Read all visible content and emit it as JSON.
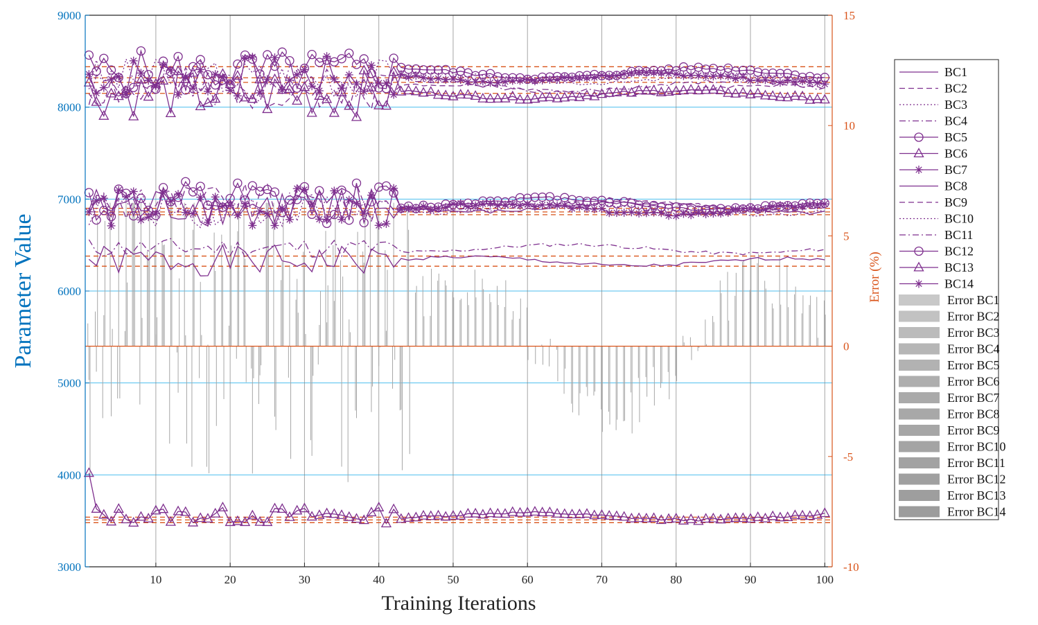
{
  "chart_data": {
    "type": "line",
    "xlabel": "Training Iterations",
    "ylabel_left": "Parameter Value",
    "ylabel_right": "Error (%)",
    "xlim": [
      0.5,
      101
    ],
    "xticks": [
      10,
      20,
      30,
      40,
      50,
      60,
      70,
      80,
      90,
      100
    ],
    "ylim_left": [
      3000,
      9000
    ],
    "yticks_left": [
      3000,
      4000,
      5000,
      6000,
      7000,
      8000,
      9000
    ],
    "ylim_right": [
      -10,
      15
    ],
    "yticks_right": [
      -10,
      -5,
      0,
      5,
      10,
      15
    ],
    "yticks_right_labels": [
      "-10",
      "-5",
      "0",
      "5",
      "10",
      "15"
    ],
    "grid": "on",
    "legend_position": "outside-right",
    "colors": {
      "series": "#7E2F8E",
      "error_axis": "#D95319",
      "reference": "#D95319",
      "grid_h": "#4DBEEE",
      "grid_v": "#808080",
      "error_bars": "#A6A6A6"
    },
    "series": [
      {
        "name": "BC1",
        "style": "solid",
        "marker": "none",
        "group": 3,
        "base": 6330,
        "amp_early": 170,
        "amp_late": 45,
        "seed": 1
      },
      {
        "name": "BC2",
        "style": "dashed",
        "marker": "none",
        "group": 1,
        "base": 8200,
        "amp_early": 230,
        "amp_late": 55,
        "seed": 2
      },
      {
        "name": "BC3",
        "style": "dotted",
        "marker": "none",
        "group": 1,
        "base": 8320,
        "amp_early": 220,
        "amp_late": 50,
        "seed": 3
      },
      {
        "name": "BC4",
        "style": "dashdot",
        "marker": "none",
        "group": 1,
        "base": 8240,
        "amp_early": 240,
        "amp_late": 60,
        "seed": 4
      },
      {
        "name": "BC5",
        "style": "solid",
        "marker": "circle",
        "group": 1,
        "base": 8380,
        "amp_early": 240,
        "amp_late": 55,
        "seed": 5
      },
      {
        "name": "BC6",
        "style": "solid",
        "marker": "triangle",
        "group": 1,
        "base": 8150,
        "amp_early": 260,
        "amp_late": 45,
        "seed": 6
      },
      {
        "name": "BC7",
        "style": "solid",
        "marker": "star",
        "group": 1,
        "base": 8330,
        "amp_early": 230,
        "amp_late": 45,
        "seed": 7
      },
      {
        "name": "BC8",
        "style": "solid",
        "marker": "none",
        "group": 2,
        "base": 6920,
        "amp_early": 220,
        "amp_late": 55,
        "seed": 8
      },
      {
        "name": "BC9",
        "style": "dashed",
        "marker": "none",
        "group": 2,
        "base": 6950,
        "amp_early": 220,
        "amp_late": 55,
        "seed": 9
      },
      {
        "name": "BC10",
        "style": "dotted",
        "marker": "none",
        "group": 2,
        "base": 6900,
        "amp_early": 210,
        "amp_late": 50,
        "seed": 10
      },
      {
        "name": "BC11",
        "style": "dashdot",
        "marker": "none",
        "group": 3,
        "base": 6470,
        "amp_early": 110,
        "amp_late": 45,
        "seed": 11
      },
      {
        "name": "BC12",
        "style": "solid",
        "marker": "circle",
        "group": 2,
        "base": 6960,
        "amp_early": 230,
        "amp_late": 55,
        "seed": 12
      },
      {
        "name": "BC13",
        "style": "solid",
        "marker": "triangle",
        "group": 4,
        "base": 3560,
        "amp_early": 90,
        "amp_late": 35,
        "seed": 13
      },
      {
        "name": "BC14",
        "style": "solid",
        "marker": "star",
        "group": 2,
        "base": 6900,
        "amp_early": 220,
        "amp_late": 55,
        "seed": 14
      }
    ],
    "reference_lines_left": [
      8440,
      8320,
      8270,
      8150,
      6900,
      6860,
      6830,
      6380,
      6270,
      3540,
      3510,
      3480
    ],
    "error_series": [
      {
        "name": "Error BC1",
        "gray": "#C8C8C8"
      },
      {
        "name": "Error BC2",
        "gray": "#C2C2C2"
      },
      {
        "name": "Error BC3",
        "gray": "#BBBBBB"
      },
      {
        "name": "Error BC4",
        "gray": "#B6B6B6"
      },
      {
        "name": "Error BC5",
        "gray": "#B2B2B2"
      },
      {
        "name": "Error BC6",
        "gray": "#AEAEAE"
      },
      {
        "name": "Error BC7",
        "gray": "#AAAAAA"
      },
      {
        "name": "Error BC8",
        "gray": "#A8A8A8"
      },
      {
        "name": "Error BC9",
        "gray": "#A6A6A6"
      },
      {
        "name": "Error BC10",
        "gray": "#A4A4A4"
      },
      {
        "name": "Error BC11",
        "gray": "#A2A2A2"
      },
      {
        "name": "Error BC12",
        "gray": "#A0A0A0"
      },
      {
        "name": "Error BC13",
        "gray": "#9E9E9E"
      },
      {
        "name": "Error BC14",
        "gray": "#9C9C9C"
      }
    ]
  }
}
